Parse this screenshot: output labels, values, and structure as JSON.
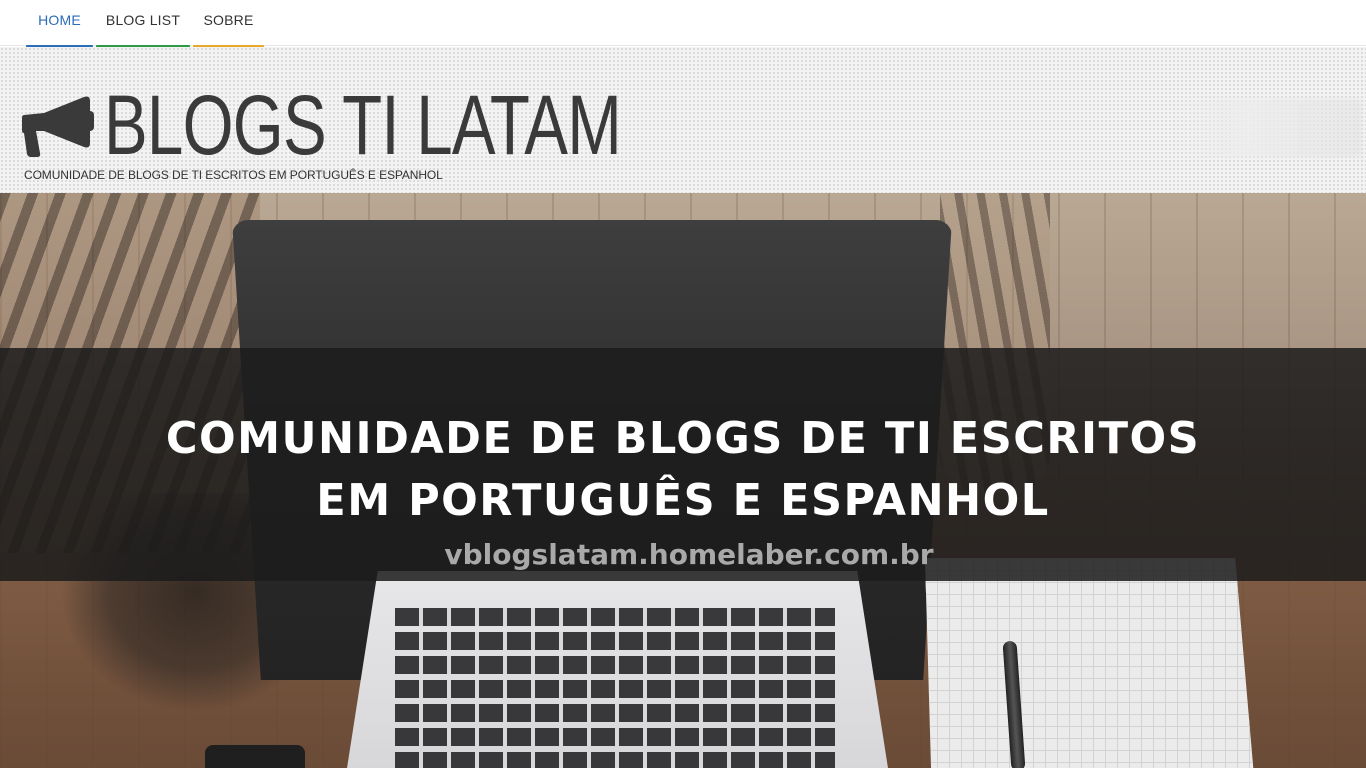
{
  "nav": {
    "items": [
      {
        "label": "HOME",
        "color": "#2b6cb8",
        "active": true
      },
      {
        "label": "BLOG LIST",
        "color": "#2e9a46",
        "active": false
      },
      {
        "label": "SOBRE",
        "color": "#e8a82a",
        "active": false
      }
    ]
  },
  "header": {
    "logo_text": "BLOGS TI LATAM",
    "subtitle": "COMUNIDADE DE BLOGS DE TI ESCRITOS EM PORTUGUÊS E ESPANHOL",
    "logo_icon": "megaphone-icon"
  },
  "hero": {
    "headline_line1": "COMUNIDADE DE BLOGS DE TI ESCRITOS",
    "headline_line2": "EM PORTUGUÊS E ESPANHOL",
    "url": "vblogslatam.homelaber.com.br"
  }
}
